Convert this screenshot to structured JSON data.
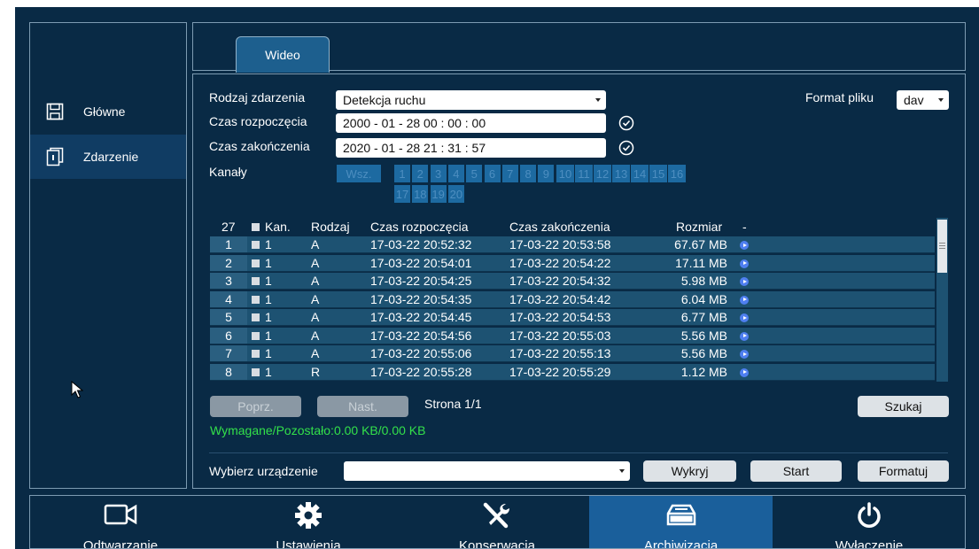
{
  "tab": {
    "label": "Wideo"
  },
  "sidebar": {
    "items": [
      {
        "label": "Główne",
        "icon": "save-icon"
      },
      {
        "label": "Zdarzenie",
        "icon": "event-file-icon"
      }
    ]
  },
  "search": {
    "event_type_label": "Rodzaj zdarzenia",
    "event_type_value": "Detekcja ruchu",
    "file_format_label": "Format pliku",
    "file_format_value": "dav",
    "start_label": "Czas rozpoczęcia",
    "start_value": "2000  -  01  -  28     00  :  00  :  00",
    "end_label": "Czas zakończenia",
    "end_value": "2020  -  01  -  28     21  :  31  :  57",
    "channels_label": "Kanały",
    "channels_all": "Wsz.",
    "channels": [
      "1",
      "2",
      "3",
      "4",
      "5",
      "6",
      "7",
      "8",
      "9",
      "10",
      "11",
      "12",
      "13",
      "14",
      "15",
      "16",
      "17",
      "18",
      "19",
      "20"
    ]
  },
  "table": {
    "count": "27",
    "headers": {
      "channel": "Kan.",
      "type": "Rodzaj",
      "start": "Czas rozpoczęcia",
      "end": "Czas zakończenia",
      "size": "Rozmiar",
      "action": "-"
    },
    "rows": [
      {
        "n": "1",
        "channel": "1",
        "type": "A",
        "start": "17-03-22 20:52:32",
        "end": "17-03-22 20:53:58",
        "size": "67.67 MB"
      },
      {
        "n": "2",
        "channel": "1",
        "type": "A",
        "start": "17-03-22 20:54:01",
        "end": "17-03-22 20:54:22",
        "size": "17.11 MB"
      },
      {
        "n": "3",
        "channel": "1",
        "type": "A",
        "start": "17-03-22 20:54:25",
        "end": "17-03-22 20:54:32",
        "size": "5.98 MB"
      },
      {
        "n": "4",
        "channel": "1",
        "type": "A",
        "start": "17-03-22 20:54:35",
        "end": "17-03-22 20:54:42",
        "size": "6.04 MB"
      },
      {
        "n": "5",
        "channel": "1",
        "type": "A",
        "start": "17-03-22 20:54:45",
        "end": "17-03-22 20:54:53",
        "size": "6.77 MB"
      },
      {
        "n": "6",
        "channel": "1",
        "type": "A",
        "start": "17-03-22 20:54:56",
        "end": "17-03-22 20:55:03",
        "size": "5.56 MB"
      },
      {
        "n": "7",
        "channel": "1",
        "type": "A",
        "start": "17-03-22 20:55:06",
        "end": "17-03-22 20:55:13",
        "size": "5.56 MB"
      },
      {
        "n": "8",
        "channel": "1",
        "type": "R",
        "start": "17-03-22 20:55:28",
        "end": "17-03-22 20:55:29",
        "size": "1.12 MB"
      }
    ]
  },
  "pager": {
    "prev": "Poprz.",
    "next": "Nast.",
    "page": "Strona 1/1",
    "search": "Szukaj"
  },
  "storage_info": "Wymagane/Pozostało:0.00 KB/0.00 KB",
  "device": {
    "label": "Wybierz urządzenie",
    "value": "",
    "detect": "Wykryj",
    "start": "Start",
    "format": "Formatuj"
  },
  "bottom_nav": [
    {
      "label": "Odtwarzanie",
      "icon": "camera-icon"
    },
    {
      "label": "Ustawienia",
      "icon": "gear-icon"
    },
    {
      "label": "Konserwacja",
      "icon": "tools-icon"
    },
    {
      "label": "Archiwizacja",
      "icon": "archive-drive-icon"
    },
    {
      "label": "Wyłączenie",
      "icon": "power-icon"
    }
  ],
  "colors": {
    "background": "#092a45",
    "accent": "#1a5f9b",
    "row": "#1d5272",
    "status_text": "#33e04a"
  }
}
